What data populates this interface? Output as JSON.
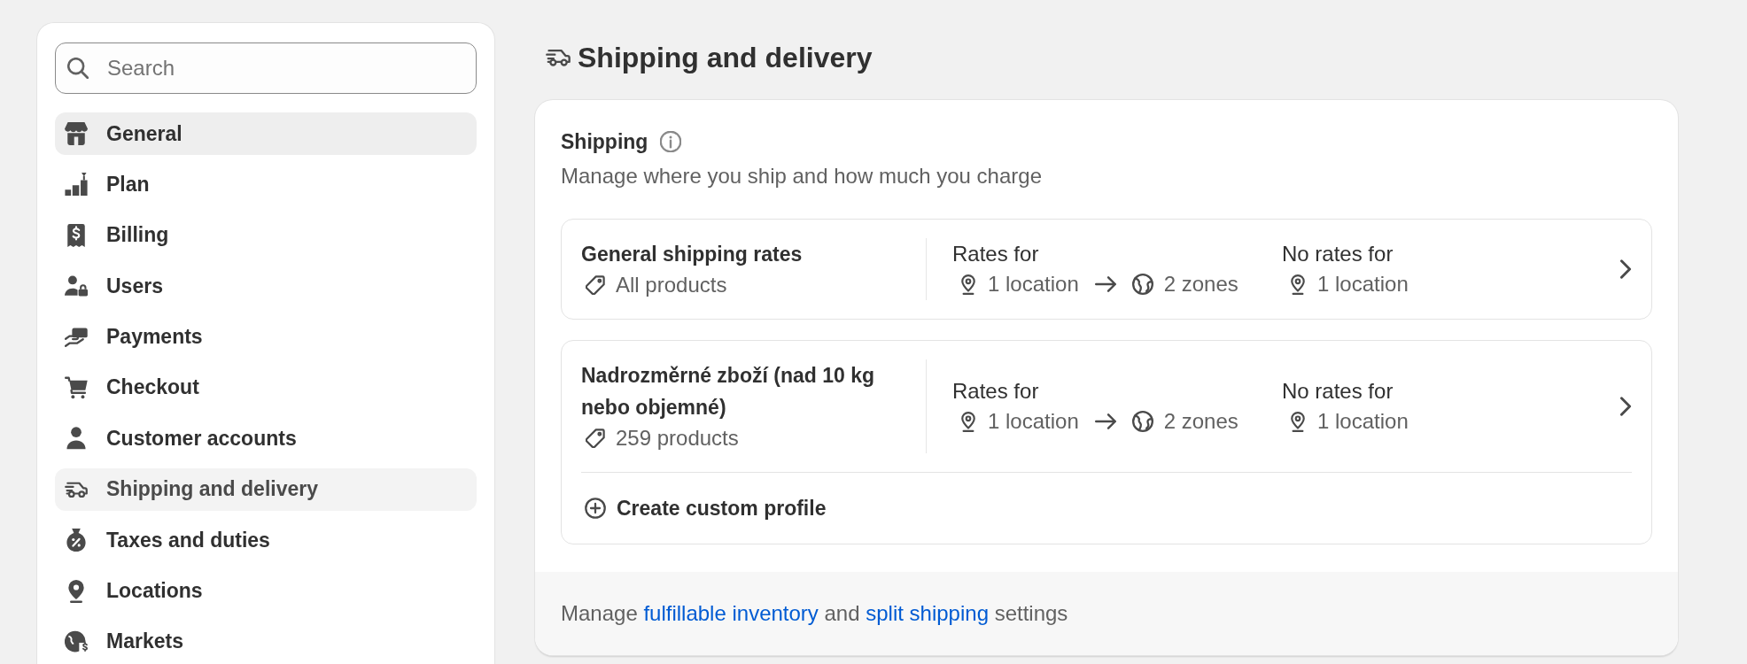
{
  "sidebar": {
    "search": {
      "placeholder": "Search"
    },
    "items": [
      {
        "label": "General",
        "selected": false,
        "hovered": true
      },
      {
        "label": "Plan",
        "selected": false,
        "hovered": false
      },
      {
        "label": "Billing",
        "selected": false,
        "hovered": false
      },
      {
        "label": "Users",
        "selected": false,
        "hovered": false
      },
      {
        "label": "Payments",
        "selected": false,
        "hovered": false
      },
      {
        "label": "Checkout",
        "selected": false,
        "hovered": false
      },
      {
        "label": "Customer accounts",
        "selected": false,
        "hovered": false
      },
      {
        "label": "Shipping and delivery",
        "selected": true,
        "hovered": false
      },
      {
        "label": "Taxes and duties",
        "selected": false,
        "hovered": false
      },
      {
        "label": "Locations",
        "selected": false,
        "hovered": false
      },
      {
        "label": "Markets",
        "selected": false,
        "hovered": false
      }
    ]
  },
  "page": {
    "title": "Shipping and delivery"
  },
  "shipping": {
    "title": "Shipping",
    "subtitle": "Manage where you ship and how much you charge",
    "general_profile": {
      "name": "General shipping rates",
      "products": "All products",
      "rates_for": {
        "label": "Rates for",
        "origin": "1 location",
        "destination": "2 zones"
      },
      "no_rates_for": {
        "label": "No rates for",
        "origin": "1 location"
      }
    },
    "custom_profiles": {
      "items": [
        {
          "name": "Nadrozměrné zboží (nad 10 kg nebo objemné)",
          "products": "259 products",
          "rates_for": {
            "label": "Rates for",
            "origin": "1 location",
            "destination": "2 zones"
          },
          "no_rates_for": {
            "label": "No rates for",
            "origin": "1 location"
          }
        }
      ],
      "create_button": "Create custom profile"
    },
    "footer": {
      "parts": [
        {
          "kind": "text",
          "text": "Manage"
        },
        {
          "kind": "link",
          "text": "fulfillable inventory"
        },
        {
          "kind": "text",
          "text": "and"
        },
        {
          "kind": "link",
          "text": "split shipping"
        },
        {
          "kind": "text",
          "text": "settings"
        }
      ]
    }
  }
}
